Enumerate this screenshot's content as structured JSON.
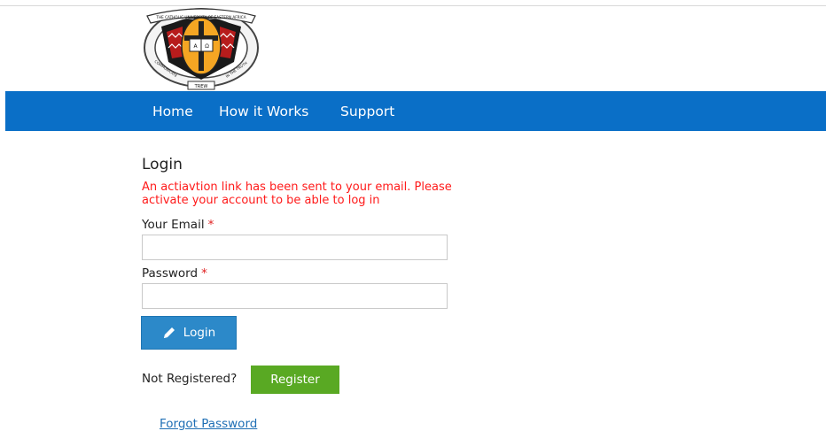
{
  "logo": {
    "ring_text_top": "THE CATHOLIC UNIVERSITY OF EASTERN AFRICA",
    "ring_text_left": "COMMUNICATE",
    "ring_text_right": "IN THE TRUTH",
    "ribbon_text": "TREW",
    "book_letters_left": "A",
    "book_letters_right": "Ω"
  },
  "nav": {
    "items": [
      {
        "label": "Home"
      },
      {
        "label": "How it Works"
      },
      {
        "label": "Support"
      }
    ],
    "background": "#0a6fc7"
  },
  "login": {
    "title": "Login",
    "alert": "An actiavtion link has been sent to your email. Please activate your account to be able to log in",
    "email_label": "Your Email",
    "password_label": "Password",
    "required_mark": "*",
    "email_value": "",
    "password_value": "",
    "login_button": "Login",
    "login_icon": "pencil-icon"
  },
  "register": {
    "prompt": "Not Registered?",
    "button": "Register",
    "color": "#59a923"
  },
  "forgot_password": "Forgot Password"
}
